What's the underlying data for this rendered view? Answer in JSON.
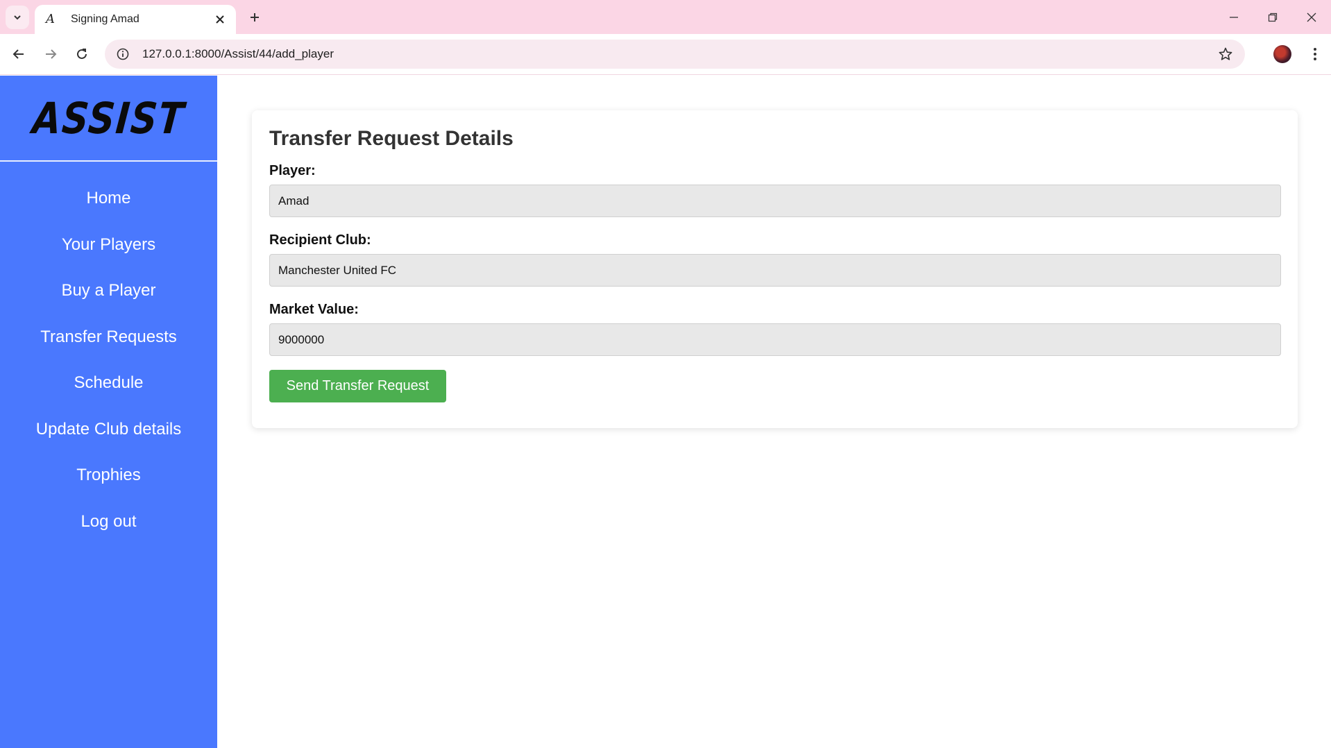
{
  "browser": {
    "tab_title": "Signing Amad",
    "tab_favicon": "A",
    "url": "127.0.0.1:8000/Assist/44/add_player"
  },
  "sidebar": {
    "logo": "ASSIST",
    "items": [
      {
        "label": "Home"
      },
      {
        "label": "Your Players"
      },
      {
        "label": "Buy a Player"
      },
      {
        "label": "Transfer Requests"
      },
      {
        "label": "Schedule"
      },
      {
        "label": "Update Club details"
      },
      {
        "label": "Trophies"
      },
      {
        "label": "Log out"
      }
    ]
  },
  "form": {
    "title": "Transfer Request Details",
    "player_label": "Player:",
    "player_value": "Amad",
    "club_label": "Recipient Club:",
    "club_value": "Manchester United FC",
    "value_label": "Market Value:",
    "value_value": "9000000",
    "submit_label": "Send Transfer Request"
  },
  "colors": {
    "tabstrip": "#fbd6e5",
    "sidebar": "#4a78fe",
    "button": "#4caf50",
    "input_bg": "#e8e8e8"
  },
  "icons": [
    "tab-search-icon",
    "close-icon",
    "plus-icon",
    "minimize-icon",
    "restore-icon",
    "close-window-icon",
    "back-arrow-icon",
    "forward-arrow-icon",
    "reload-icon",
    "info-icon",
    "star-icon",
    "kebab-menu-icon"
  ]
}
